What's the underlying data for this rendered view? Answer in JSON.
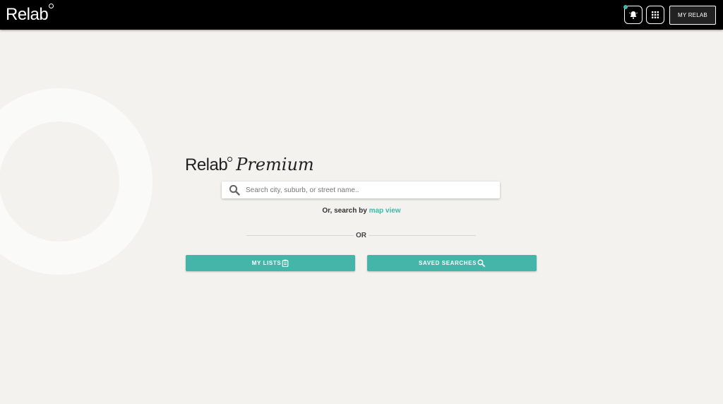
{
  "header": {
    "brand": "Relab",
    "my_relab_label": "MY RELAB",
    "notification_icon": "bell-icon",
    "apps_icon": "grid-icon"
  },
  "hero": {
    "logo_word": "Relab",
    "logo_suffix": "Premium"
  },
  "search": {
    "placeholder": "Search city, suburb, or street name..",
    "value": "",
    "icon": "search-icon"
  },
  "alt_search": {
    "prefix": "Or, search by ",
    "link_text": "map view"
  },
  "divider": {
    "label": "OR"
  },
  "actions": {
    "my_lists_label": "MY LISTS",
    "my_lists_icon": "clipboard-icon",
    "saved_searches_label": "SAVED SEARCHES",
    "saved_searches_icon": "search-icon"
  },
  "colors": {
    "accent": "#45b5aa",
    "header_bg": "#000000",
    "page_bg": "#f3f2ee"
  }
}
